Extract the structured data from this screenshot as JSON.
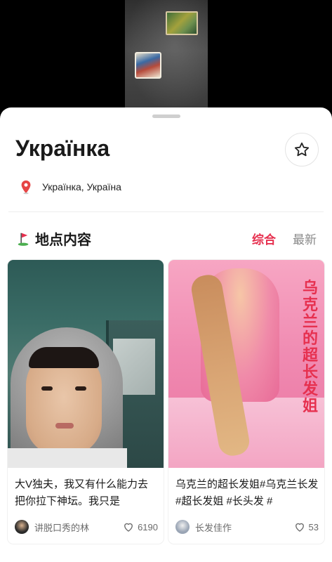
{
  "place": {
    "title": "Українка",
    "location": "Українка, Україна",
    "pin_icon": "location-pin-icon",
    "favorite_icon": "star-icon"
  },
  "section": {
    "flag_icon": "golf-flag-icon",
    "title": "地点内容",
    "tabs": [
      {
        "label": "综合",
        "active": true
      },
      {
        "label": "最新",
        "active": false
      }
    ]
  },
  "posts": [
    {
      "title": "大V独夫，我又有什么能力去把你拉下神坛。我只是",
      "author": "讲脱口秀的林",
      "likes": "6190"
    },
    {
      "title": "乌克兰的超长发姐#乌克兰长发 #超长发姐 #长头发 #",
      "author": "长发佳作",
      "likes": "53",
      "image_caption": "乌克兰的超长发姐"
    }
  ],
  "colors": {
    "accent": "#e6304f",
    "text_primary": "#1a1a1a",
    "text_secondary": "#6b6b6b"
  }
}
